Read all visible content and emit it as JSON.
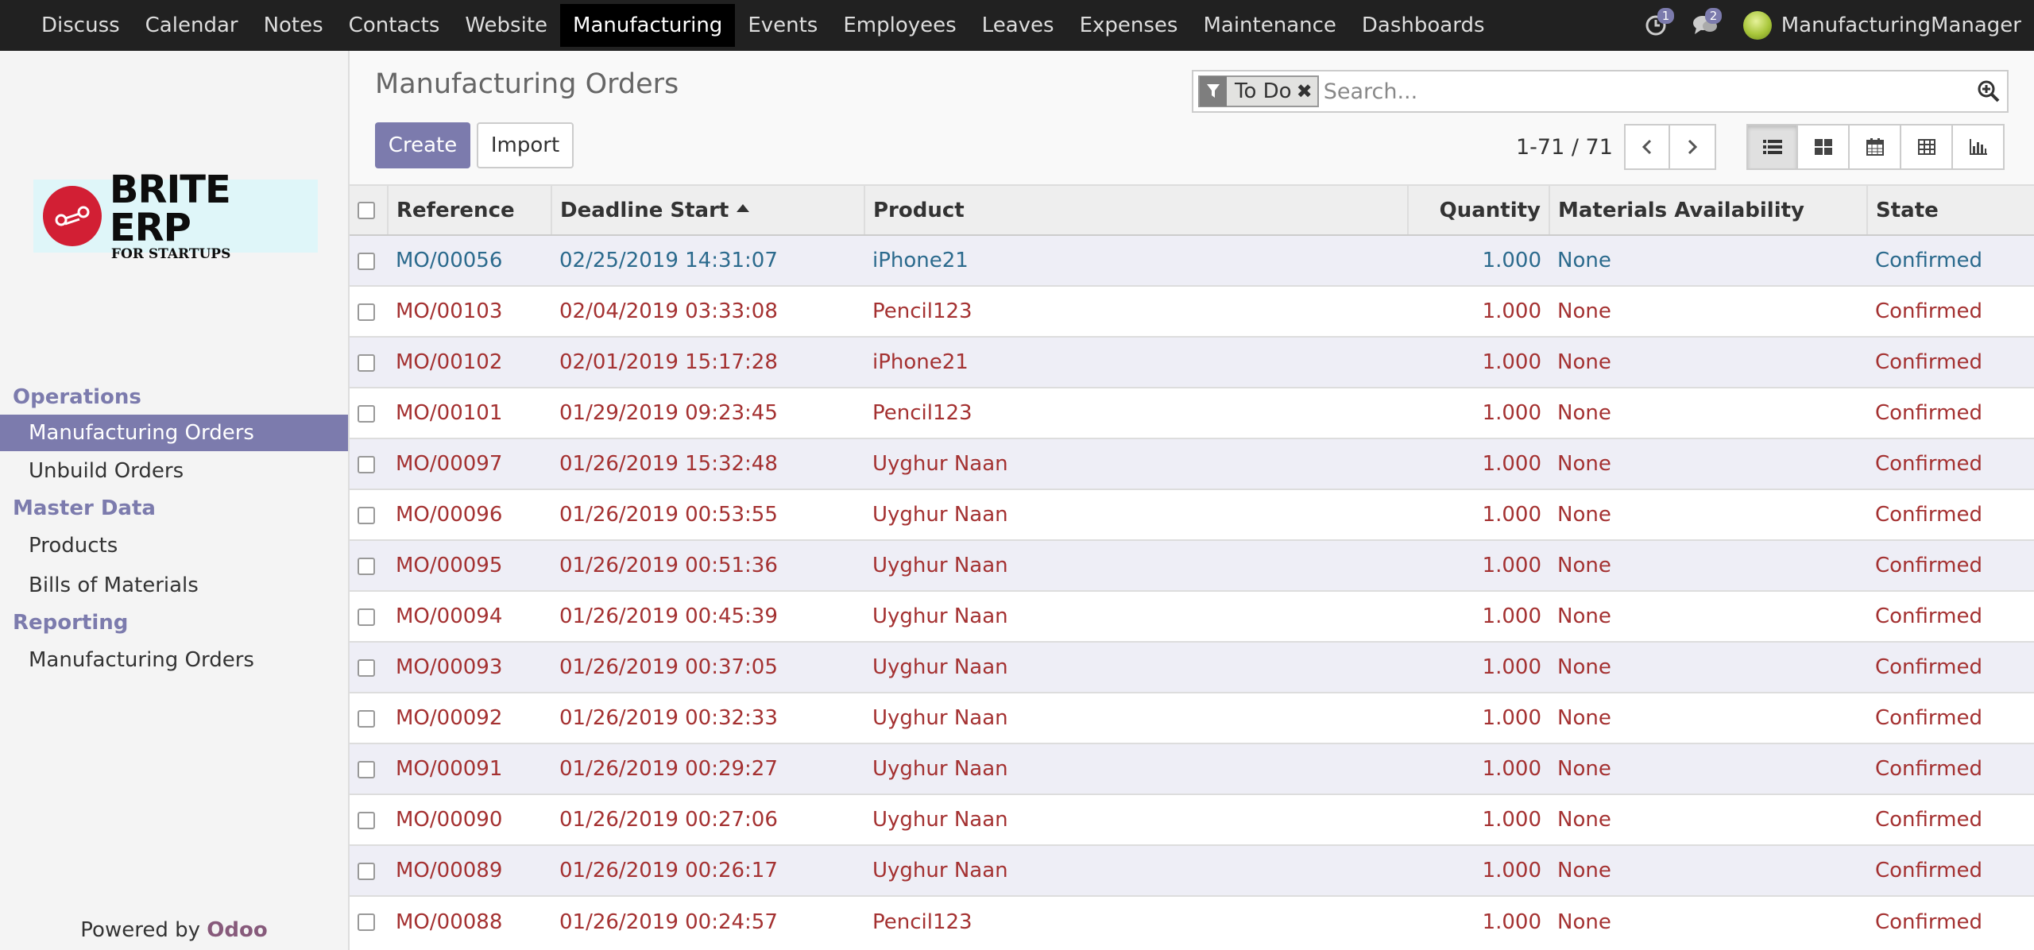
{
  "topbar": {
    "menu": [
      "Discuss",
      "Calendar",
      "Notes",
      "Contacts",
      "Website",
      "Manufacturing",
      "Events",
      "Employees",
      "Leaves",
      "Expenses",
      "Maintenance",
      "Dashboards"
    ],
    "active_menu": "Manufacturing",
    "activity_count": "1",
    "message_count": "2",
    "user_name": "ManufacturingManager"
  },
  "logo": {
    "main": "BRITE ERP",
    "sub": "FOR STARTUPS"
  },
  "sidebar": {
    "sections": [
      {
        "heading": "Operations",
        "items": [
          "Manufacturing Orders",
          "Unbuild Orders"
        ]
      },
      {
        "heading": "Master Data",
        "items": [
          "Products",
          "Bills of Materials"
        ]
      },
      {
        "heading": "Reporting",
        "items": [
          "Manufacturing Orders"
        ]
      }
    ],
    "active_item": "Manufacturing Orders",
    "powered_prefix": "Powered by ",
    "powered_brand": "Odoo"
  },
  "control_panel": {
    "title": "Manufacturing Orders",
    "create_label": "Create",
    "import_label": "Import",
    "search_placeholder": "Search...",
    "filter_facet": "To Do",
    "pager_value": "1-71 / 71"
  },
  "table": {
    "columns": [
      "Reference",
      "Deadline Start",
      "Product",
      "Quantity",
      "Materials Availability",
      "State"
    ],
    "rows": [
      {
        "ref": "MO/00056",
        "deadline": "02/25/2019 14:31:07",
        "product": "iPhone21",
        "qty": "1.000",
        "avail": "None",
        "state": "Confirmed",
        "highlight": "info"
      },
      {
        "ref": "MO/00103",
        "deadline": "02/04/2019 03:33:08",
        "product": "Pencil123",
        "qty": "1.000",
        "avail": "None",
        "state": "Confirmed",
        "highlight": "danger"
      },
      {
        "ref": "MO/00102",
        "deadline": "02/01/2019 15:17:28",
        "product": "iPhone21",
        "qty": "1.000",
        "avail": "None",
        "state": "Confirmed",
        "highlight": "danger"
      },
      {
        "ref": "MO/00101",
        "deadline": "01/29/2019 09:23:45",
        "product": "Pencil123",
        "qty": "1.000",
        "avail": "None",
        "state": "Confirmed",
        "highlight": "danger"
      },
      {
        "ref": "MO/00097",
        "deadline": "01/26/2019 15:32:48",
        "product": "Uyghur Naan",
        "qty": "1.000",
        "avail": "None",
        "state": "Confirmed",
        "highlight": "danger"
      },
      {
        "ref": "MO/00096",
        "deadline": "01/26/2019 00:53:55",
        "product": "Uyghur Naan",
        "qty": "1.000",
        "avail": "None",
        "state": "Confirmed",
        "highlight": "danger"
      },
      {
        "ref": "MO/00095",
        "deadline": "01/26/2019 00:51:36",
        "product": "Uyghur Naan",
        "qty": "1.000",
        "avail": "None",
        "state": "Confirmed",
        "highlight": "danger"
      },
      {
        "ref": "MO/00094",
        "deadline": "01/26/2019 00:45:39",
        "product": "Uyghur Naan",
        "qty": "1.000",
        "avail": "None",
        "state": "Confirmed",
        "highlight": "danger"
      },
      {
        "ref": "MO/00093",
        "deadline": "01/26/2019 00:37:05",
        "product": "Uyghur Naan",
        "qty": "1.000",
        "avail": "None",
        "state": "Confirmed",
        "highlight": "danger"
      },
      {
        "ref": "MO/00092",
        "deadline": "01/26/2019 00:32:33",
        "product": "Uyghur Naan",
        "qty": "1.000",
        "avail": "None",
        "state": "Confirmed",
        "highlight": "danger"
      },
      {
        "ref": "MO/00091",
        "deadline": "01/26/2019 00:29:27",
        "product": "Uyghur Naan",
        "qty": "1.000",
        "avail": "None",
        "state": "Confirmed",
        "highlight": "danger"
      },
      {
        "ref": "MO/00090",
        "deadline": "01/26/2019 00:27:06",
        "product": "Uyghur Naan",
        "qty": "1.000",
        "avail": "None",
        "state": "Confirmed",
        "highlight": "danger"
      },
      {
        "ref": "MO/00089",
        "deadline": "01/26/2019 00:26:17",
        "product": "Uyghur Naan",
        "qty": "1.000",
        "avail": "None",
        "state": "Confirmed",
        "highlight": "danger"
      },
      {
        "ref": "MO/00088",
        "deadline": "01/26/2019 00:24:57",
        "product": "Pencil123",
        "qty": "1.000",
        "avail": "None",
        "state": "Confirmed",
        "highlight": "danger"
      }
    ]
  },
  "colors": {
    "accent": "#7c7bad",
    "topbar": "#212121",
    "row_danger": "#a43131",
    "row_info": "#2b6a8d",
    "brand_odoo": "#875a7b",
    "logo_red": "#d21f34"
  },
  "icons": {
    "activity": "clock-icon",
    "messages": "chat-icon",
    "filter": "funnel-icon",
    "search": "search-plus-icon",
    "pager_prev": "chevron-left-icon",
    "pager_next": "chevron-right-icon",
    "views": [
      "list-view-icon",
      "kanban-view-icon",
      "calendar-view-icon",
      "pivot-view-icon",
      "graph-view-icon"
    ]
  }
}
